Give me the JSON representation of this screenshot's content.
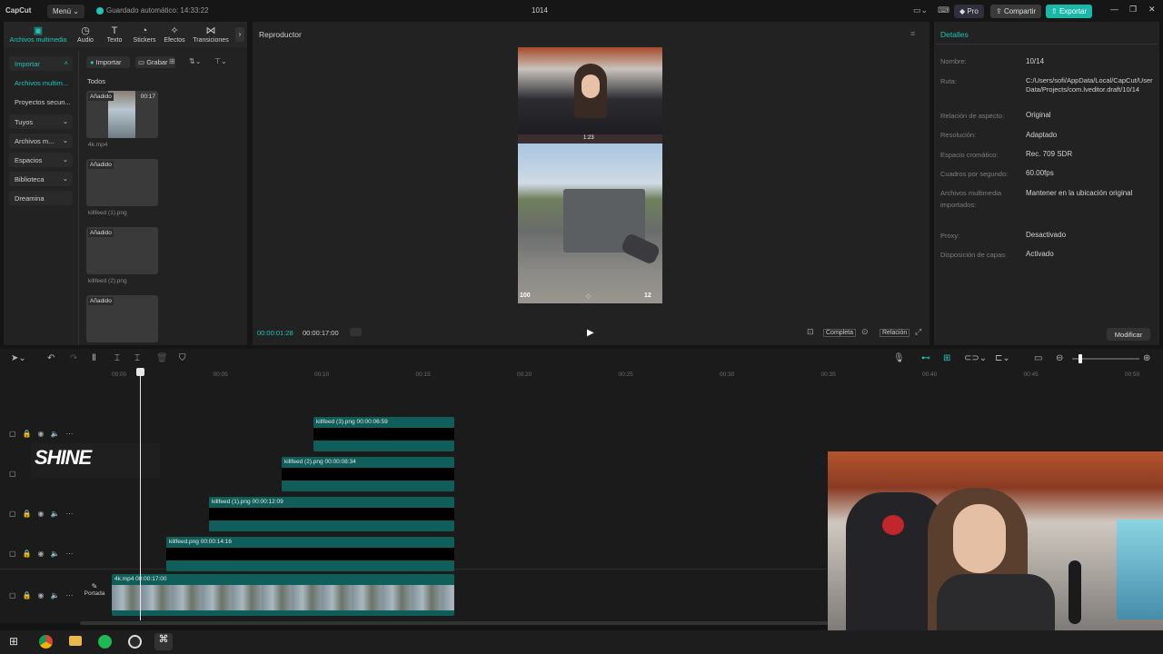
{
  "app": {
    "logo": "CapCut",
    "menu_label": "Menú",
    "autosave": "Guardado automático: 14:33:22",
    "project_title": "1014",
    "pro_label": "Pro",
    "share_label": "Compartir",
    "export_label": "Exportar"
  },
  "toolbar": {
    "items": [
      {
        "label": "Archivos multimedia",
        "icon": "media-icon"
      },
      {
        "label": "Audio",
        "icon": "audio-icon"
      },
      {
        "label": "Texto",
        "icon": "text-icon"
      },
      {
        "label": "Stickers",
        "icon": "sticker-icon"
      },
      {
        "label": "Efectos",
        "icon": "effects-icon"
      },
      {
        "label": "Transiciones",
        "icon": "transitions-icon"
      }
    ]
  },
  "sidebar": {
    "items": [
      {
        "label": "Importar"
      },
      {
        "label": "Archivos multim..."
      },
      {
        "label": "Proyectos secun..."
      },
      {
        "label": "Tuyos"
      },
      {
        "label": "Archivos m..."
      },
      {
        "label": "Espacios"
      },
      {
        "label": "Biblioteca"
      },
      {
        "label": "Dreamina"
      }
    ]
  },
  "media": {
    "import_button": "Importar",
    "record_button": "Grabar",
    "section_label": "Todos",
    "items": [
      {
        "badge": "Añadido",
        "duration": "00:17",
        "name": "4k.mp4"
      },
      {
        "badge": "Añadido",
        "name": "killfeed (1).png"
      },
      {
        "badge": "Añadido",
        "name": "killfeed (2).png"
      },
      {
        "badge": "Añadido",
        "name": ""
      }
    ]
  },
  "player": {
    "title": "Reproductor",
    "current_time": "00:00:01:28",
    "total_time": "00:00:17:00",
    "complete_label": "Completa",
    "ratio_label": "Relación",
    "overlay": {
      "hp": "100",
      "timer": "1:23",
      "ammo": "12"
    }
  },
  "details": {
    "title": "Detalles",
    "rows": [
      {
        "key": "Nombre:",
        "value": "10/14"
      },
      {
        "key": "Ruta:",
        "value": "C:/Users/sofi/AppData/Local/CapCut/User Data/Projects/com.lveditor.draft/10/14"
      },
      {
        "key": "Relación de aspecto:",
        "value": "Original"
      },
      {
        "key": "Resolución:",
        "value": "Adaptado"
      },
      {
        "key": "Espacio cromático:",
        "value": "Rec. 709 SDR"
      },
      {
        "key": "Cuadros por segundo:",
        "value": "60.00fps"
      },
      {
        "key": "Archivos multimedia importados:",
        "value": "Mantener en la ubicación original"
      },
      {
        "key": "Proxy:",
        "value": "Desactivado"
      },
      {
        "key": "Disposición de capas:",
        "value": "Activado"
      }
    ],
    "modify_button": "Modificar"
  },
  "timeline": {
    "ticks": [
      "00:00",
      "00:05",
      "00:10",
      "00:15",
      "00:20",
      "00:25",
      "00:30",
      "00:35",
      "00:40",
      "00:45",
      "00:50"
    ],
    "clips": [
      {
        "name": "killfeed (3).png",
        "duration": "00:00:06:59"
      },
      {
        "name": "killfeed (2).png",
        "duration": "00:00:08:34"
      },
      {
        "name": "killfeed (1).png",
        "duration": "00:00:12:09"
      },
      {
        "name": "killfeed.png",
        "duration": "00:00:14:16"
      },
      {
        "name": "4k.mp4",
        "duration": "00:00:17:00"
      }
    ],
    "text_clip": "SHINE",
    "cover_label": "Portada"
  },
  "colors": {
    "accent": "#1fc6b8",
    "clip": "#0f5e5a",
    "export": "#19b8a8"
  }
}
